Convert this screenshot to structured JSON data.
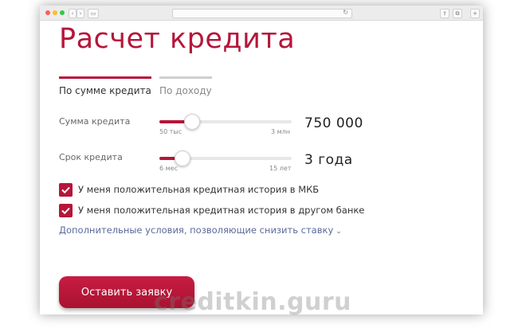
{
  "page": {
    "title": "Расчет кредита"
  },
  "tabs": [
    {
      "label": "По сумме кредита",
      "active": true
    },
    {
      "label": "По доходу",
      "active": false
    }
  ],
  "loan_amount": {
    "label": "Сумма кредита",
    "min_label": "50 тыс",
    "max_label": "3 млн",
    "value": "750 000",
    "slider_fraction": 0.24
  },
  "loan_term": {
    "label": "Срок кредита",
    "min_label": "6 мес",
    "max_label": "15 лет",
    "value": "3 года",
    "slider_fraction": 0.17
  },
  "checkboxes": [
    {
      "label": "У меня положительная кредитная история в МКБ",
      "checked": true
    },
    {
      "label": "У меня положительная кредитная история в другом банке",
      "checked": true
    }
  ],
  "more_conditions": {
    "label": "Дополнительные условия, позволяющие снизить ставку",
    "icon": "chevron-down-icon"
  },
  "submit_button": {
    "label": "Оставить заявку"
  },
  "watermark": "creditkin.guru",
  "colors": {
    "accent": "#b5163a",
    "link": "#5a6a9a",
    "inactive_tab": "#cfcfcf"
  }
}
